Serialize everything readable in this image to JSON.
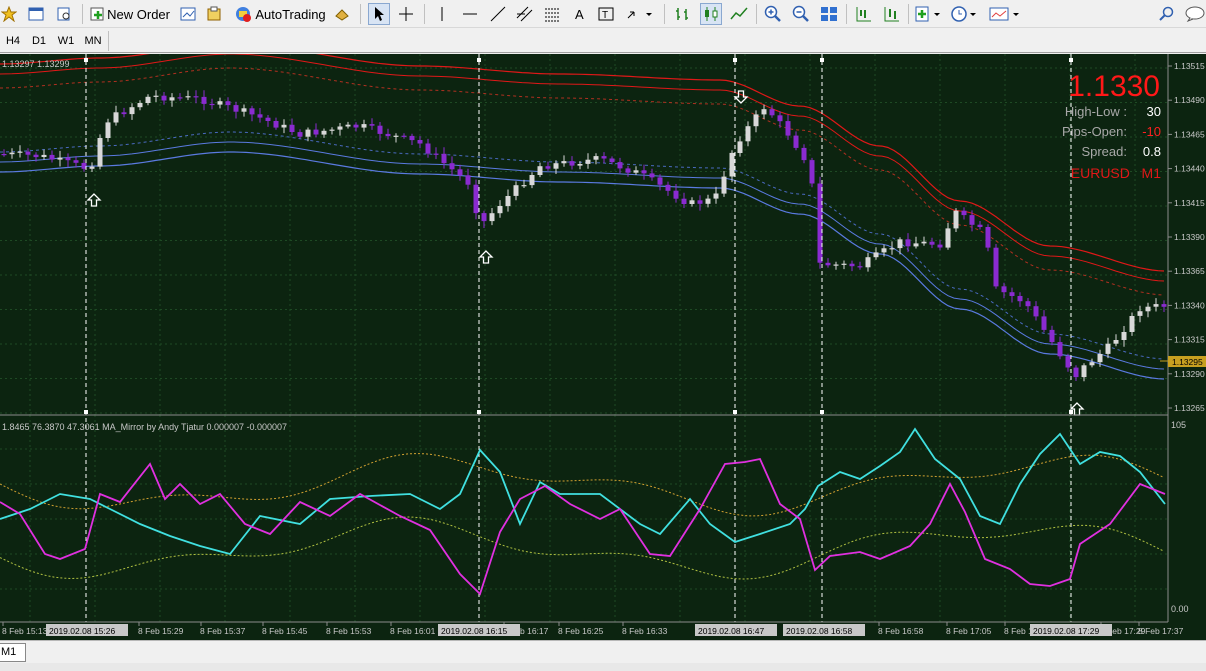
{
  "toolbar": {
    "new_order": "New Order",
    "autotrading": "AutoTrading"
  },
  "timeframes": [
    "H4",
    "D1",
    "W1",
    "MN"
  ],
  "chart": {
    "symbol": "EURUSD",
    "timeframe": "M1",
    "top_left_info": "1.13297 1.13299",
    "big_price": "1.1330",
    "info": [
      {
        "label": "High-Low :",
        "value": "30"
      },
      {
        "label": "Pips-Open:",
        "value": "-10"
      },
      {
        "label": "Spread:",
        "value": "0.8"
      }
    ],
    "symbol_line": "EURUSD   M1",
    "price_scale": [
      "1.13515",
      "1.13490",
      "1.13465",
      "1.13440",
      "1.13415",
      "1.13390",
      "1.13365",
      "1.13340",
      "1.13315",
      "1.13290",
      "1.13265"
    ],
    "current_price_label": "1.13295",
    "indicator_label": "1.8465 76.3870 47.3061  MA_Mirror by Andy Tjatur 0.000007 -0.000007",
    "indicator_scale_top": "105",
    "indicator_scale_bottom": "0.00",
    "time_labels": [
      "8 Feb 15:13",
      "8 Feb 15:29",
      "8 Feb 15:37",
      "8 Feb 15:45",
      "8 Feb 15:53",
      "8 Feb 16:01",
      "8 Feb 16:17",
      "8 Feb 16:25",
      "8 Feb 16:33",
      "8 Feb 16:58",
      "8 Feb 17:05",
      "8 Feb 17:13",
      "8 Feb 17:29",
      "8 Feb 17:37"
    ],
    "highlighted_times": [
      "2019.02.08 15:26",
      "2019.02.08 16:15",
      "2019.02.08 16:47",
      "2019.02.08 16:58",
      "2019.02.08 17:29"
    ]
  },
  "statusbar": {
    "tab": "M1"
  },
  "colors": {
    "chart_bg": "#0c2410",
    "bull": "#d8d8d8",
    "bear": "#8a2bd0",
    "band_red": "#e01818",
    "band_blue": "#5a7ae0",
    "cyan": "#40e0e0",
    "magenta": "#e030e0"
  }
}
